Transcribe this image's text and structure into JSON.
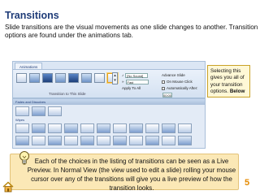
{
  "slide": {
    "title": "Transitions",
    "body": "Slide transitions are the visual movements as one slide changes to another. Transition options are found under the animations tab.",
    "page_number": "5",
    "accent": "#1f3c78",
    "page_number_color": "#e58a00"
  },
  "ribbon": {
    "tab_label": "Animations",
    "group_label": "Transition to This Slide",
    "sound_label": "[No Sound]",
    "speed_label": "Fast",
    "apply_label": "Apply To All",
    "advance_label": "Advance Slide",
    "mouse_label": "On Mouse Click",
    "auto_label": "Automatically After:",
    "time_value": "00:00"
  },
  "callout": {
    "text": "Selecting this gives you all of your transition options.",
    "emphasis": "Below"
  },
  "pane": {
    "header": "Fades and Dissolves",
    "subheader": "Wipes"
  },
  "tip": {
    "text": "Each of the choices in the listing of transitions can be seen as a Live Preview. In Normal View (the view used to edit a slide) rolling your mouse cursor over any of the transitions will give you a live preview of how the transition looks."
  },
  "icons": {
    "bulb": "lightbulb-icon",
    "home": "home-icon"
  }
}
